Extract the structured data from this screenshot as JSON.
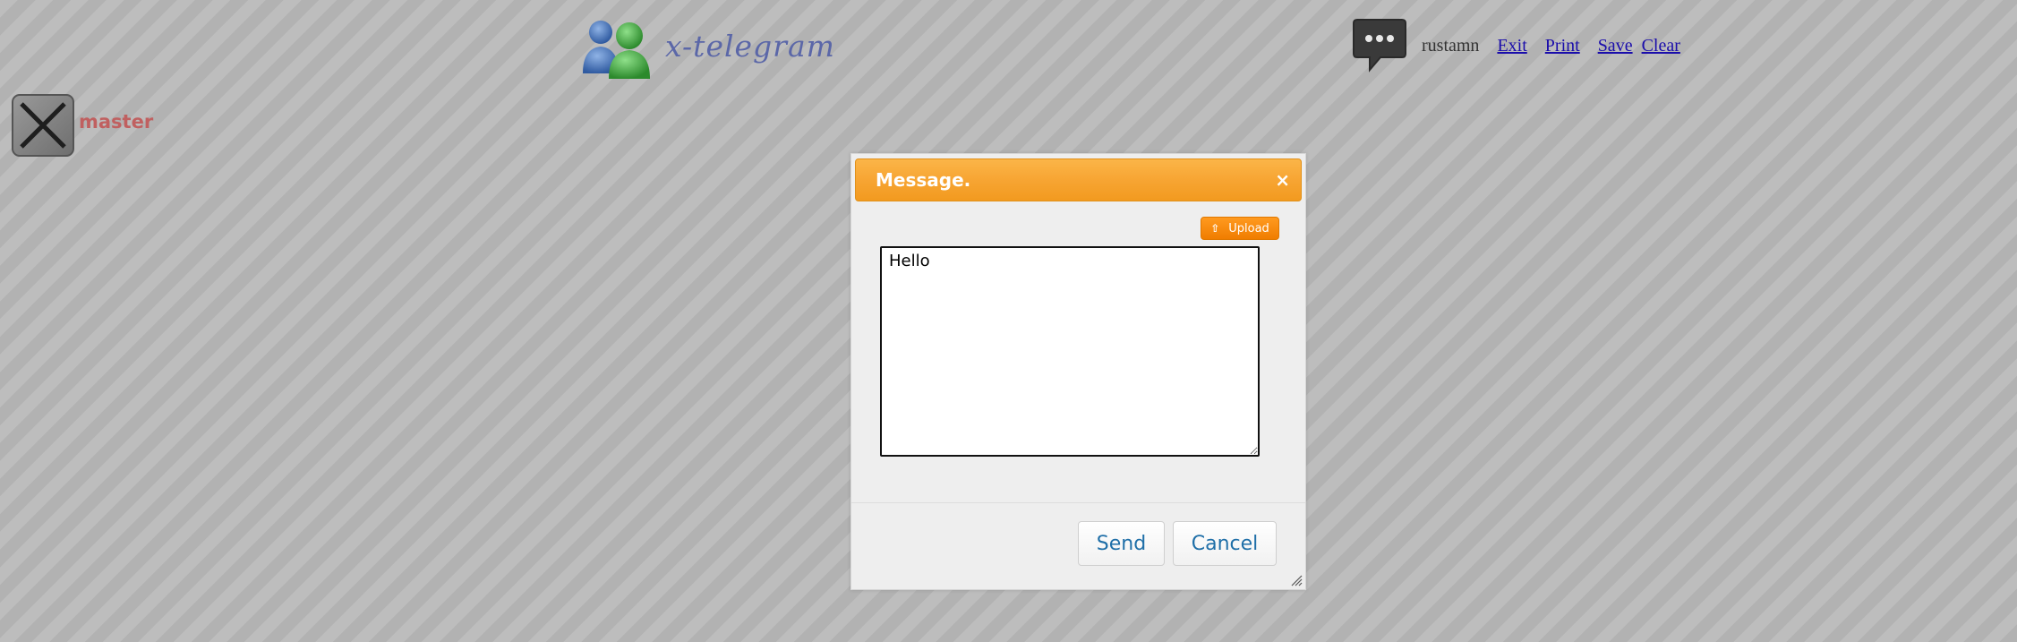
{
  "header": {
    "logo_text": "x-telegram",
    "user_name": "rustamn",
    "nav": [
      {
        "label": "Exit"
      },
      {
        "label": "Print"
      },
      {
        "label": "Save"
      },
      {
        "label": "Clear"
      }
    ]
  },
  "sidebar": {
    "user_label": "master"
  },
  "dialog": {
    "title": "Message.",
    "close_glyph": "×",
    "upload_label": "Upload",
    "message_value": "Hello ",
    "send_label": "Send",
    "cancel_label": "Cancel"
  },
  "icons": {
    "logo": "users-icon",
    "chat": "chat-bubble-icon",
    "master": "close-x-avatar-icon",
    "upload": "arrow-up-icon",
    "resize": "resize-grip-icon"
  },
  "colors": {
    "dialog_title_bar": "#f7a533",
    "upload_button": "#f58a0a",
    "button_text": "#1f6fa8",
    "link": "#1a0dab",
    "master_label": "#c06060",
    "logo_text": "#5b67a8"
  }
}
